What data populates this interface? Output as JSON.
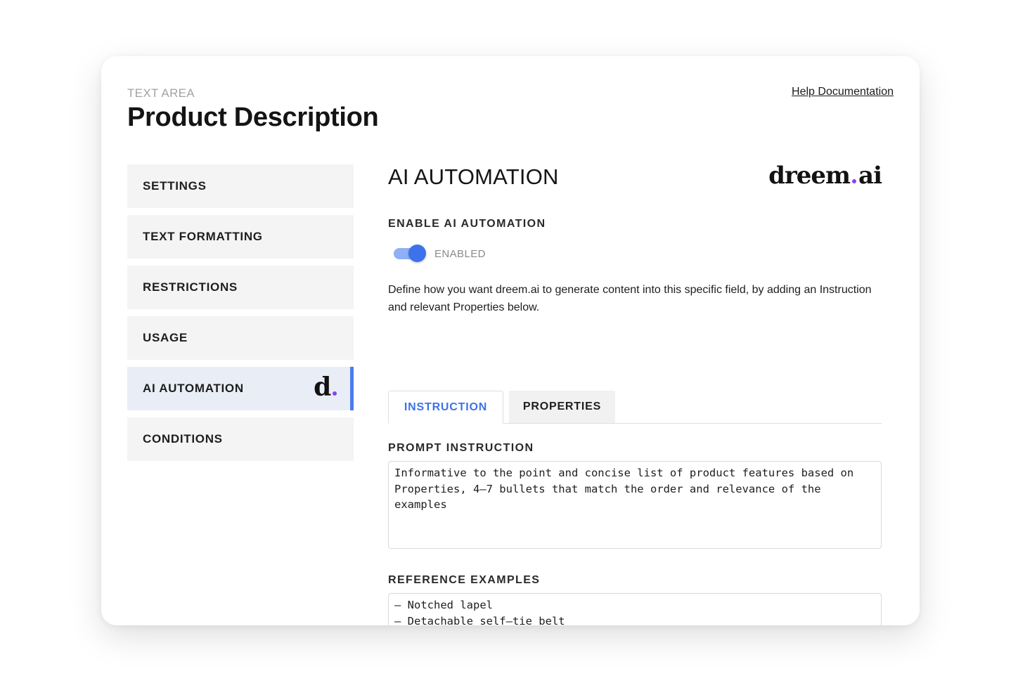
{
  "header": {
    "overline": "TEXT AREA",
    "title": "Product Description",
    "help_link": "Help Documentation"
  },
  "sidebar": {
    "items": [
      {
        "label": "SETTINGS"
      },
      {
        "label": "TEXT FORMATTING"
      },
      {
        "label": "RESTRICTIONS"
      },
      {
        "label": "USAGE"
      },
      {
        "label": "AI AUTOMATION",
        "active": true,
        "badge": "d"
      },
      {
        "label": "CONDITIONS"
      }
    ]
  },
  "main": {
    "heading": "AI AUTOMATION",
    "brand": {
      "left": "dreem",
      "right": "ai"
    },
    "enable_label": "ENABLE AI AUTOMATION",
    "toggle": {
      "state": "on",
      "label": "ENABLED"
    },
    "description": "Define how you want dreem.ai to generate content into this specific field, by adding an Instruction and relevant Properties below.",
    "tabs": [
      {
        "label": "INSTRUCTION",
        "active": true
      },
      {
        "label": "PROPERTIES",
        "active": false
      }
    ],
    "prompt_label": "PROMPT INSTRUCTION",
    "prompt_value": "Informative to the point and concise list of product features based on Properties, 4–7 bullets that match the order and relevance of the examples",
    "examples_label": "REFERENCE EXAMPLES",
    "examples_value": "– Notched lapel\n– Detachable self–tie belt\n– Welt pockets at front and interior\n– Full logo–woven stain lining"
  },
  "colors": {
    "accent": "#3d72ec",
    "accent_light": "#8fb0f6",
    "brand_dot": "#8a3ff0",
    "active_item_bg": "#e9eef6",
    "item_bg": "#f4f4f4"
  }
}
